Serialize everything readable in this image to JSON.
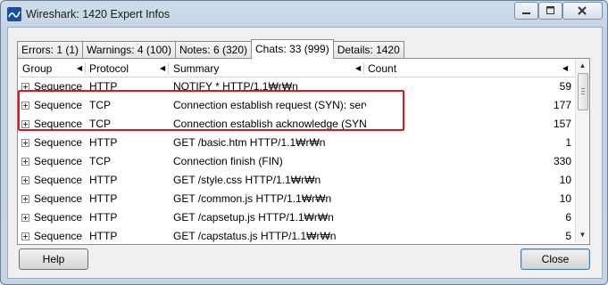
{
  "window": {
    "title": "Wireshark: 1420 Expert Infos"
  },
  "tabs": [
    {
      "label": "Errors: 1 (1)"
    },
    {
      "label": "Warnings: 4 (100)"
    },
    {
      "label": "Notes: 6 (320)"
    },
    {
      "label": "Chats: 33 (999)"
    },
    {
      "label": "Details: 1420"
    }
  ],
  "columns": {
    "group": "Group",
    "protocol": "Protocol",
    "summary": "Summary",
    "count": "Count"
  },
  "rows": [
    {
      "group": "Sequence",
      "protocol": "HTTP",
      "summary": "NOTIFY * HTTP/1.1₩r₩n",
      "count": "59"
    },
    {
      "group": "Sequence",
      "protocol": "TCP",
      "summary": "Connection establish request (SYN): server",
      "count": "177"
    },
    {
      "group": "Sequence",
      "protocol": "TCP",
      "summary": "Connection establish acknowledge (SYN+A",
      "count": "157"
    },
    {
      "group": "Sequence",
      "protocol": "HTTP",
      "summary": "GET /basic.htm HTTP/1.1₩r₩n",
      "count": "1"
    },
    {
      "group": "Sequence",
      "protocol": "TCP",
      "summary": "Connection finish (FIN)",
      "count": "330"
    },
    {
      "group": "Sequence",
      "protocol": "HTTP",
      "summary": "GET /style.css HTTP/1.1₩r₩n",
      "count": "10"
    },
    {
      "group": "Sequence",
      "protocol": "HTTP",
      "summary": "GET /common.js HTTP/1.1₩r₩n",
      "count": "10"
    },
    {
      "group": "Sequence",
      "protocol": "HTTP",
      "summary": "GET /capsetup.js HTTP/1.1₩r₩n",
      "count": "6"
    },
    {
      "group": "Sequence",
      "protocol": "HTTP",
      "summary": "GET /capstatus.js HTTP/1.1₩r₩n",
      "count": "5"
    }
  ],
  "buttons": {
    "help": "Help",
    "close": "Close"
  },
  "colors": {
    "highlight": "#e0151c"
  }
}
